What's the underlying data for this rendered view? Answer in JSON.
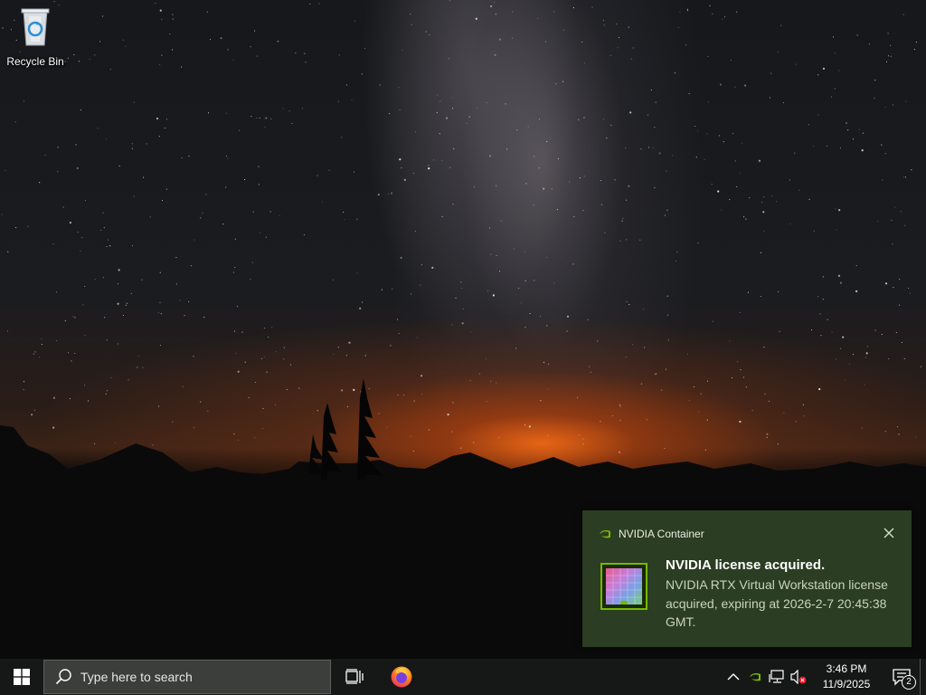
{
  "desktop": {
    "icons": [
      {
        "label": "Recycle Bin",
        "icon": "recycle-bin-icon"
      }
    ]
  },
  "notification": {
    "app_name": "NVIDIA Container",
    "title": "NVIDIA license acquired.",
    "body": "NVIDIA RTX Virtual Workstation license acquired, expiring at 2026-2-7 20:45:38 GMT.",
    "icon": "nvidia-icon",
    "close_icon": "close-icon",
    "accent_color": "#76b900"
  },
  "taskbar": {
    "start_icon": "windows-logo-icon",
    "search": {
      "placeholder": "Type here to search",
      "icon": "search-icon"
    },
    "task_view_icon": "task-view-icon",
    "pinned": [
      {
        "name": "Firefox",
        "icon": "firefox-icon"
      }
    ],
    "tray": {
      "icons": [
        "chevron-up-icon",
        "nvidia-icon",
        "network-icon",
        "volume-muted-icon"
      ],
      "time": "3:46 PM",
      "date": "11/9/2025",
      "notification_count": "2"
    }
  }
}
